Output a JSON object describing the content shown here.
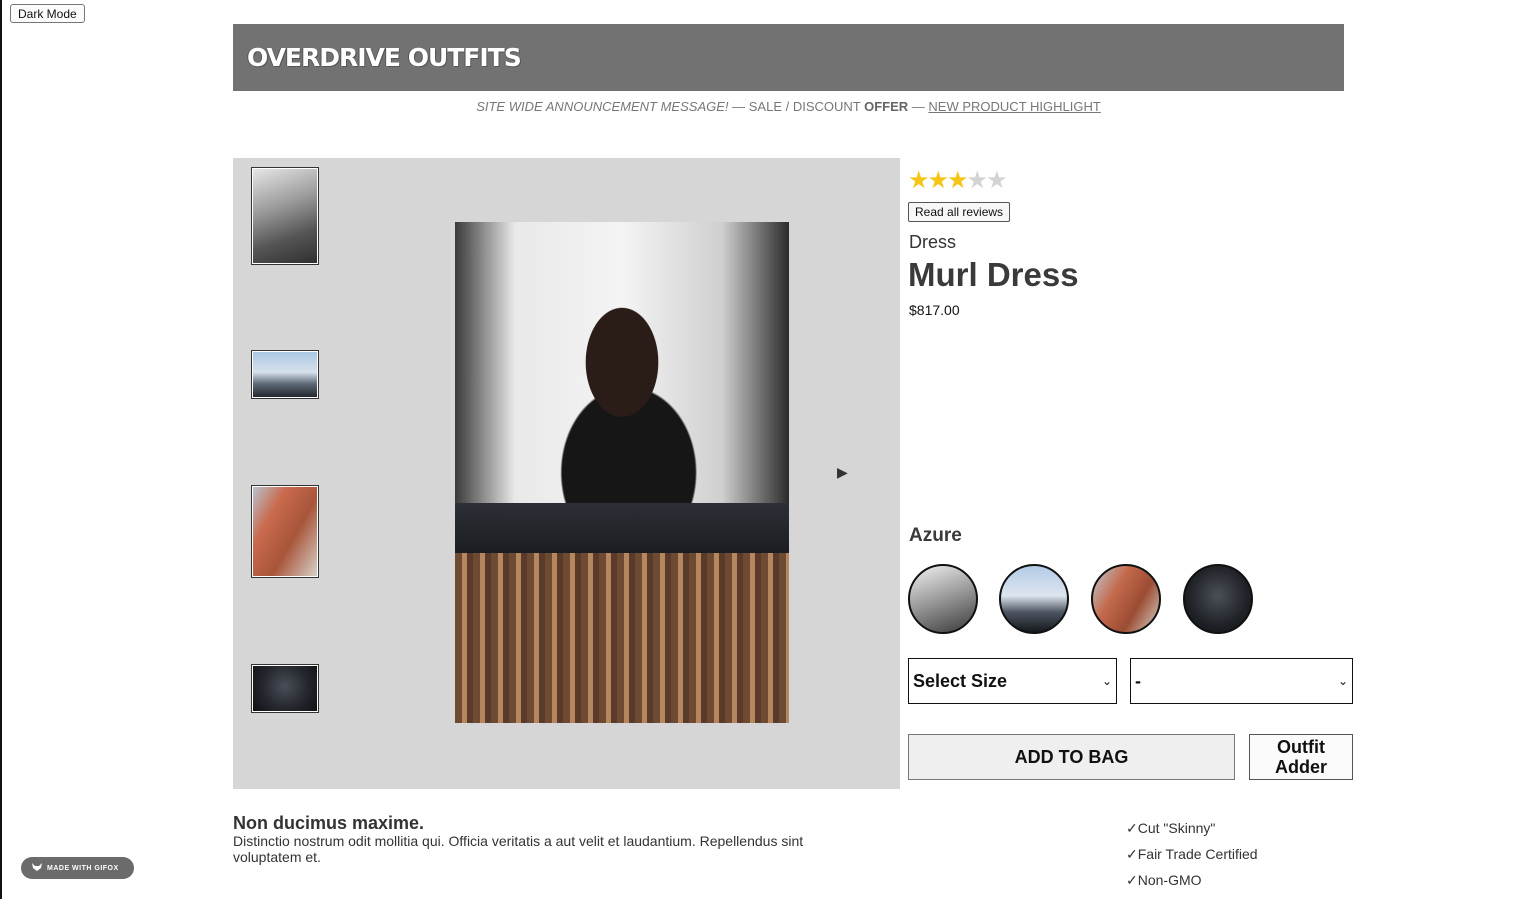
{
  "controls": {
    "dark_mode_label": "Dark Mode"
  },
  "header": {
    "brand": "OVERDRIVE OUTFITS"
  },
  "announcement": {
    "message": "SITE WIDE ANNOUNCEMENT MESSAGE!",
    "sep1": "— SALE / DISCOUNT",
    "offer": "OFFER",
    "sep2": "—",
    "link": "NEW PRODUCT HIGHLIGHT"
  },
  "gallery": {
    "thumbnails": [
      "thumb-1",
      "thumb-2",
      "thumb-3",
      "thumb-4"
    ],
    "next_icon": "▶"
  },
  "product": {
    "rating": 3,
    "rating_max": 5,
    "star_glyph": "★",
    "read_reviews_label": "Read all reviews",
    "category": "Dress",
    "name": "Murl Dress",
    "price": "$817.00",
    "selected_style": "Azure",
    "size_select": {
      "value": "Select Size",
      "chevron": "⌄"
    },
    "qty_select": {
      "value": "-",
      "chevron": "⌄"
    },
    "add_to_bag_label": "ADD TO BAG",
    "outfit_adder_line1": "Outfit",
    "outfit_adder_line2": "Adder"
  },
  "description": {
    "heading": "Non ducimus maxime.",
    "body": "Distinctio nostrum odit mollitia qui. Officia veritatis a aut velit et laudantium. Repellendus sint voluptatem et."
  },
  "features": [
    "✓Cut \"Skinny\"",
    "✓Fair Trade Certified",
    "✓Non-GMO"
  ],
  "watermark": {
    "text": "MADE WITH GIFOX"
  },
  "colors": {
    "banner": "#727272",
    "gallery_bg": "#d6d6d6",
    "star": "#f5c518",
    "star_empty": "#d3d3d3"
  }
}
